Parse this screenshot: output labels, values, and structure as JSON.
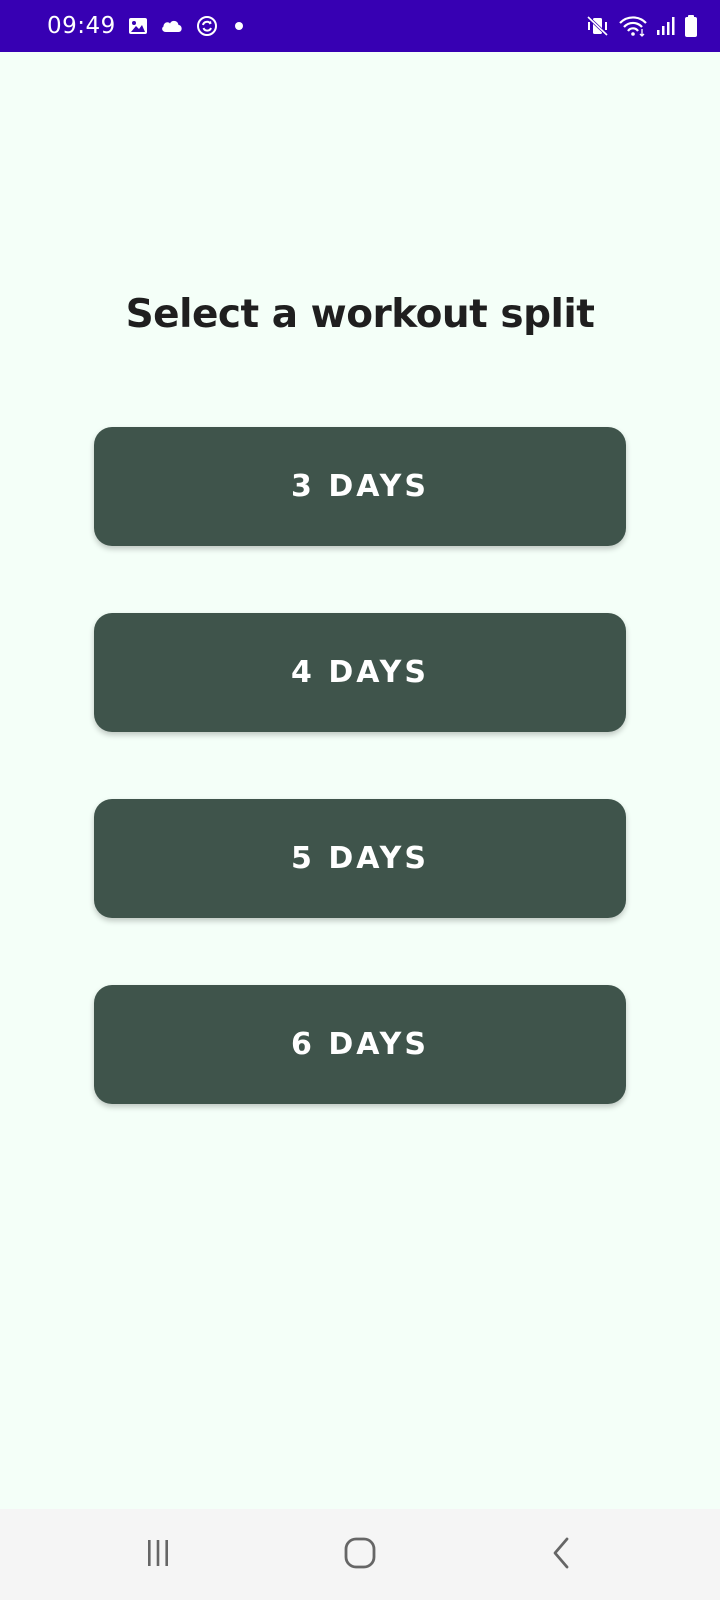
{
  "status_bar": {
    "time": "09:49",
    "left_icons": [
      "gallery-icon",
      "cloud-icon",
      "sync-icon",
      "dot-icon"
    ],
    "right_icons": [
      "vibrate-mute-icon",
      "wifi-icon",
      "signal-icon",
      "battery-icon"
    ]
  },
  "main": {
    "title": "Select a workout split",
    "buttons": [
      {
        "label": "3 DAYS"
      },
      {
        "label": "4 DAYS"
      },
      {
        "label": "5 DAYS"
      },
      {
        "label": "6 DAYS"
      }
    ]
  },
  "nav_bar": {
    "items": [
      "recents-icon",
      "home-icon",
      "back-icon"
    ]
  },
  "colors": {
    "status_bar": "#3700b3",
    "background": "#f4fff8",
    "button": "#3f544b",
    "title_text": "#1f1f1f"
  }
}
